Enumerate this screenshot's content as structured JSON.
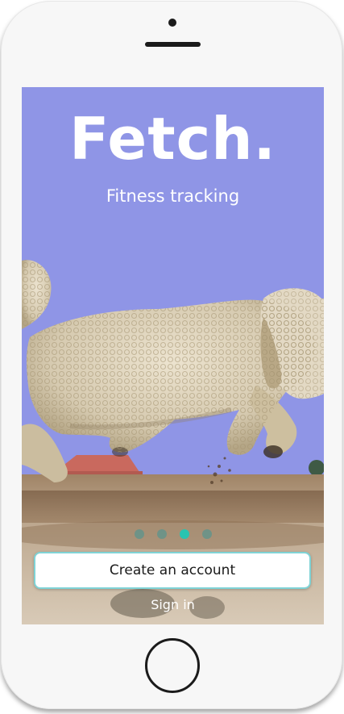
{
  "app": {
    "title": "Fetch.",
    "subtitle": "Fitness tracking"
  },
  "onboarding": {
    "page_count": 4,
    "active_page": 3
  },
  "actions": {
    "create_account_label": "Create an account",
    "sign_in_label": "Sign in"
  },
  "colors": {
    "sky": "#8f95e6",
    "accent": "#29c4b0",
    "button_border": "#7fd3d6",
    "text_on_image": "#ffffff"
  },
  "icons": {
    "home_button": "home-button-icon",
    "camera": "front-camera-icon",
    "speaker": "speaker-grille-icon"
  }
}
